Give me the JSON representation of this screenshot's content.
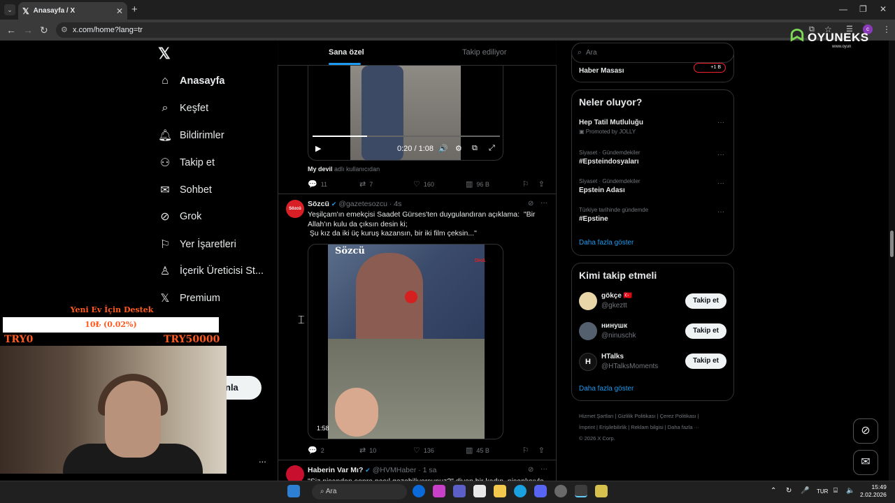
{
  "browser": {
    "tab_title": "Anasayfa / X",
    "url": "x.com/home?lang=tr",
    "new_tab": "+"
  },
  "nav": {
    "items": [
      {
        "label": "Anasayfa",
        "icon": "home-icon"
      },
      {
        "label": "Keşfet",
        "icon": "search-icon"
      },
      {
        "label": "Bildirimler",
        "icon": "bell-icon"
      },
      {
        "label": "Takip et",
        "icon": "follow-icon"
      },
      {
        "label": "Sohbet",
        "icon": "mail-icon"
      },
      {
        "label": "Grok",
        "icon": "grok-icon"
      },
      {
        "label": "Yer İşaretleri",
        "icon": "bookmark-icon"
      },
      {
        "label": "İçerik Üreticisi St...",
        "icon": "creator-icon"
      },
      {
        "label": "Premium",
        "icon": "x-icon"
      }
    ],
    "post_button_partial": "nla",
    "more": "..."
  },
  "overlay": {
    "donate_title": "Yeni Ev İçin Destek",
    "donate_progress": "10₺ (0.02%)",
    "donate_fraction": 0.0002,
    "min": "TRY0",
    "max": "TRY50000"
  },
  "feed": {
    "tabs": [
      "Sana özel",
      "Takip ediliyor"
    ],
    "tweet1": {
      "video_time": "0:20 / 1:08",
      "video_progress": 0.29,
      "caption_bold": "My devil",
      "caption_rest": "adlı kullanıcıdan",
      "replies": "11",
      "retweets": "7",
      "likes": "160",
      "views": "96 B"
    },
    "tweet2": {
      "name": "Sözcü",
      "handle": "@gazetesozcu",
      "time": "· 4s",
      "text": "Yeşilçam'ın emekçisi Saadet Gürses'ten duygulandıran açıklama:  \"Bir Allah'ın kulu da çıksın desin ki;\n Şu kız da iki üç kuruş kazansın, bir iki film çeksin...\"",
      "video_overlay_text": "Sözcü",
      "video_watermark": "DHA",
      "duration": "1:58",
      "replies": "2",
      "retweets": "10",
      "likes": "136",
      "views": "45 B",
      "avatar_text": "Sözcü"
    },
    "tweet3": {
      "name": "Haberin Var Mı?",
      "handle": "@HVMHaber",
      "time": "· 1 sa",
      "text": "\"Siz nişandan sonra nasıl gezebiliyorsunuz?\" diyen bir kadın, nişanlısıyla"
    }
  },
  "right": {
    "search_placeholder": "Ara",
    "top_card_title": "Haber Masası",
    "top_card_badge": "+1 B",
    "trends_title": "Neler oluyor?",
    "trends": [
      {
        "context": "",
        "title": "Hep Tatil Mutluluğu",
        "sub": "Promoted by JOLLY"
      },
      {
        "context": "Siyaset · Gündemdekiler",
        "title": "#Epsteindosyaları",
        "sub": ""
      },
      {
        "context": "Siyaset · Gündemdekiler",
        "title": "Epstein Adası",
        "sub": ""
      },
      {
        "context": "Türkiye tarihinde gündemde",
        "title": "#Epstine",
        "sub": ""
      }
    ],
    "show_more": "Daha fazla göster",
    "who_title": "Kimi takip etmeli",
    "who": [
      {
        "name": "gökçe 🇹🇷",
        "handle": "@gkeztt",
        "button": "Takip et"
      },
      {
        "name": "нинушк",
        "handle": "@ninuschk",
        "button": "Takip et"
      },
      {
        "name": "HTalks",
        "handle": "@HTalksMoments",
        "button": "Takip et"
      }
    ],
    "footer_links": [
      "Hizmet Şartları",
      "Gizlilik Politikası",
      "Çerez Politikası",
      "İmprint",
      "Erişilebilirlik",
      "Reklam bilgisi",
      "Daha fazla ···"
    ],
    "copyright": "© 2026 X Corp."
  },
  "logo": {
    "name": "OYUNEKS",
    "sub": "www.oyun"
  },
  "taskbar": {
    "search": "Ara",
    "lang": "TUR",
    "time": "15:49",
    "date": "2.02.2026"
  }
}
